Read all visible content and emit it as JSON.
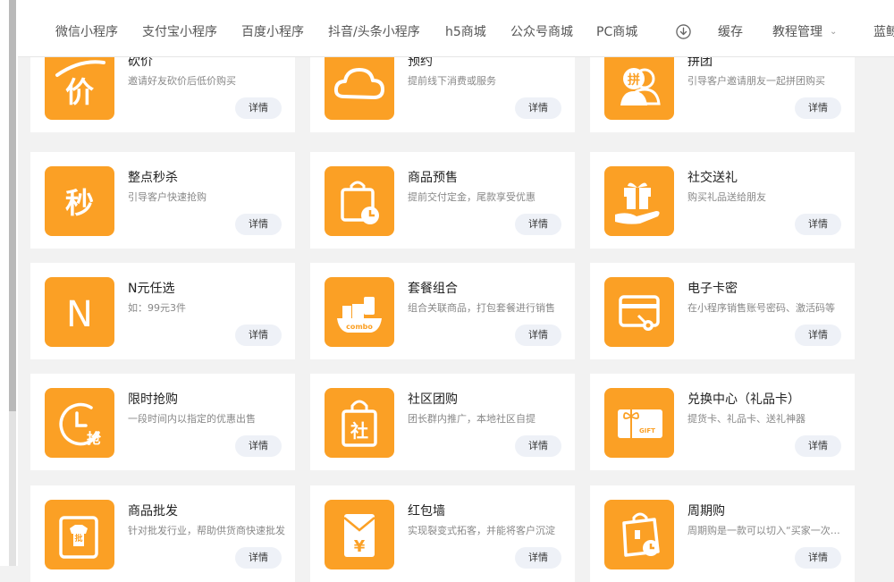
{
  "nav": {
    "items": [
      "微信小程序",
      "支付宝小程序",
      "百度小程序",
      "抖音/头条小程序",
      "h5商城",
      "公众号商城",
      "PC商城"
    ],
    "download_icon": "download-circle-icon",
    "cache_label": "缓存",
    "tutorial_label": "教程管理",
    "truncated_label": "蓝鲸"
  },
  "colors": {
    "accent": "#fba025",
    "button_bg": "#eef1f7",
    "page_bg": "#f2f2f2"
  },
  "cards": [
    {
      "title": "砍价",
      "desc": "邀请好友砍价后低价购买",
      "button": "详情",
      "icon": "bargain-icon",
      "glyph": "价"
    },
    {
      "title": "预约",
      "desc": "提前线下消费或服务",
      "button": "详情",
      "icon": "cloud-icon"
    },
    {
      "title": "拼团",
      "desc": "引导客户邀请朋友一起拼团购买",
      "button": "详情",
      "icon": "group-buy-icon",
      "glyph": "拼"
    },
    {
      "title": "整点秒杀",
      "desc": "引导客户快速抢购",
      "button": "详情",
      "icon": "flash-sale-icon",
      "glyph": "秒"
    },
    {
      "title": "商品预售",
      "desc": "提前交付定金，尾款享受优惠",
      "button": "详情",
      "icon": "presale-bag-icon"
    },
    {
      "title": "社交送礼",
      "desc": "购买礼品送给朋友",
      "button": "详情",
      "icon": "gift-hand-icon"
    },
    {
      "title": "N元任选",
      "desc": "如：99元3件",
      "button": "详情",
      "icon": "n-choice-icon",
      "glyph": "N"
    },
    {
      "title": "套餐组合",
      "desc": "组合关联商品，打包套餐进行销售",
      "button": "详情",
      "icon": "combo-icon",
      "glyph": "combo"
    },
    {
      "title": "电子卡密",
      "desc": "在小程序销售账号密码、激活码等",
      "button": "详情",
      "icon": "card-key-icon"
    },
    {
      "title": "限时抢购",
      "desc": "一段时间内以指定的优惠出售",
      "button": "详情",
      "icon": "timed-sale-icon",
      "glyph": "抢"
    },
    {
      "title": "社区团购",
      "desc": "团长群内推广，本地社区自提",
      "button": "详情",
      "icon": "community-bag-icon",
      "glyph": "社"
    },
    {
      "title": "兑换中心（礼品卡）",
      "desc": "提货卡、礼品卡、送礼神器",
      "button": "详情",
      "icon": "gift-card-icon",
      "glyph": "GIFT"
    },
    {
      "title": "商品批发",
      "desc": "针对批发行业，帮助供货商快速批发",
      "button": "详情",
      "icon": "wholesale-icon",
      "glyph": "批"
    },
    {
      "title": "红包墙",
      "desc": "实现裂变式拓客，并能将客户沉淀",
      "button": "详情",
      "icon": "red-packet-icon",
      "glyph": "¥"
    },
    {
      "title": "周期购",
      "desc": "周期购是一款可以切入“买家一次下单”",
      "button": "详情",
      "icon": "cycle-buy-icon"
    }
  ]
}
